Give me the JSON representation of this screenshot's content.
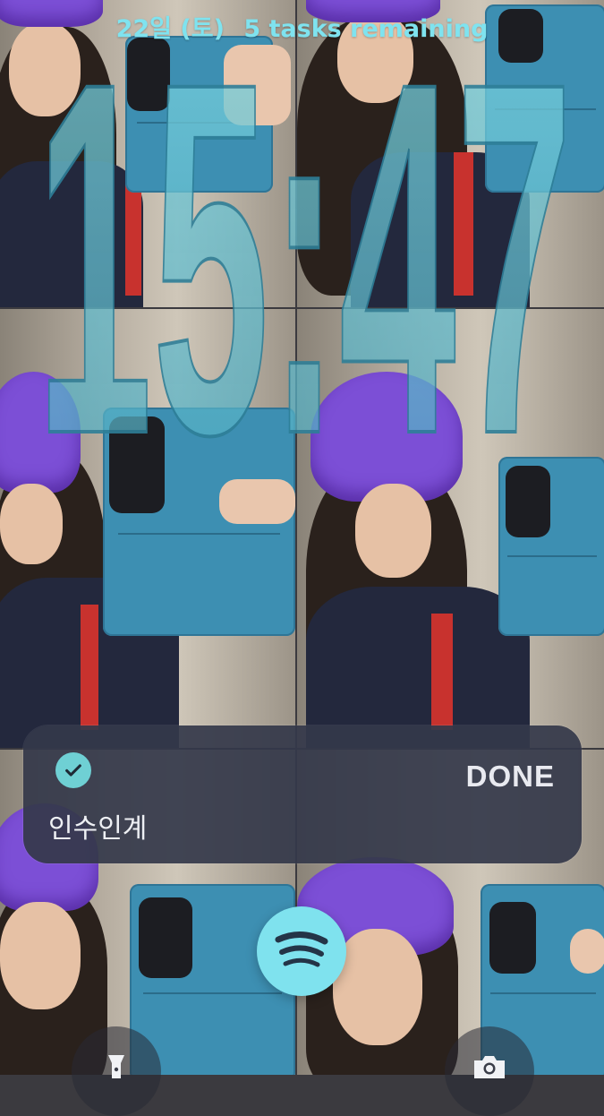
{
  "status": {
    "date": "22일 (토)",
    "tasks": "5 tasks remaining"
  },
  "clock": {
    "time": "15:47"
  },
  "notification": {
    "title": "인수인계",
    "action": "DONE",
    "check_icon": "check-circle-icon"
  },
  "dock": {
    "music_icon": "spotify-icon",
    "left_icon": "flashlight-icon",
    "right_icon": "camera-icon"
  },
  "colors": {
    "accent": "#7fe3ef",
    "notification_bg": "#34384a",
    "check": "#6fd0d4"
  }
}
